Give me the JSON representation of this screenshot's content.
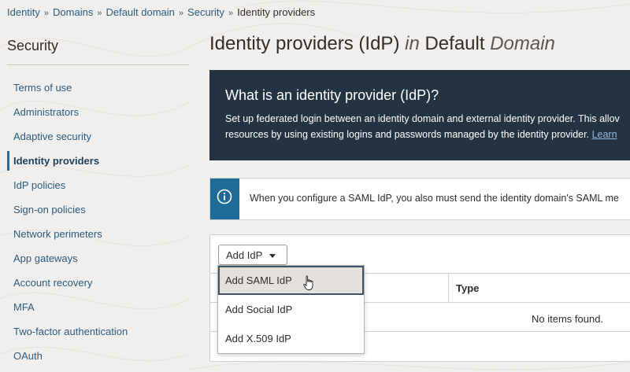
{
  "breadcrumb": {
    "items": [
      "Identity",
      "Domains",
      "Default domain",
      "Security"
    ],
    "current": "Identity providers"
  },
  "sidebar": {
    "title": "Security",
    "items": [
      {
        "label": "Terms of use"
      },
      {
        "label": "Administrators"
      },
      {
        "label": "Adaptive security"
      },
      {
        "label": "Identity providers",
        "active": true
      },
      {
        "label": "IdP policies"
      },
      {
        "label": "Sign-on policies"
      },
      {
        "label": "Network perimeters"
      },
      {
        "label": "App gateways"
      },
      {
        "label": "Account recovery"
      },
      {
        "label": "MFA"
      },
      {
        "label": "Two-factor authentication"
      },
      {
        "label": "OAuth"
      }
    ]
  },
  "page": {
    "title_prefix": "Identity providers (IdP)",
    "title_in": "in",
    "title_default": "Default",
    "title_domain": "Domain"
  },
  "info": {
    "heading": "What is an identity provider (IdP)?",
    "line1": "Set up federated login between an identity domain and external identity provider. This allov",
    "line2": "resources by using existing logins and passwords managed by the identity provider.",
    "link": "Learn"
  },
  "notice": {
    "icon": "info-icon",
    "text": "When you configure a SAML IdP, you also must send the identity domain's SAML me"
  },
  "table": {
    "add_button": "Add IdP",
    "columns": [
      "",
      "Type"
    ],
    "empty_text": "No items found."
  },
  "dropdown": {
    "items": [
      "Add SAML IdP",
      "Add Social IdP",
      "Add X.509 IdP"
    ],
    "hovered_index": 0
  },
  "colors": {
    "link": "#2b5a7f",
    "info_panel_bg": "#243341",
    "notice_accent": "#1f6a96",
    "active_indicator": "#2b6a98"
  }
}
